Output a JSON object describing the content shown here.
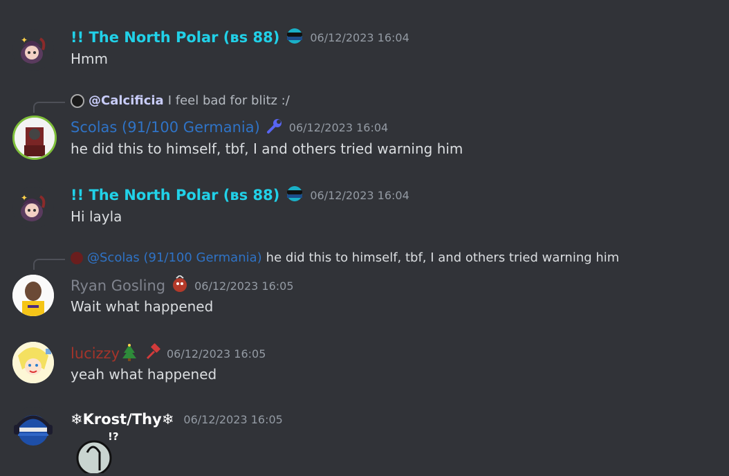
{
  "messages": [
    {
      "author": "!! The North Polar (ʙs 88)",
      "author_color": "#21d1e8",
      "timestamp": "06/12/2023 16:04",
      "text": "Hmm",
      "badge_icon": "sunglasses-ball-icon"
    },
    {
      "reply": {
        "mention": "@Calcificia",
        "text": "I feel bad for blitz :/"
      },
      "author": "Scolas (91/100 Germania)",
      "author_color": "#2f73c6",
      "timestamp": "06/12/2023 16:04",
      "text": "he did this to himself, tbf, I and others tried warning him",
      "badge_icon": "wrench-icon"
    },
    {
      "author": "!! The North Polar (ʙs 88)",
      "author_color": "#21d1e8",
      "timestamp": "06/12/2023 16:04",
      "text": "Hi layla",
      "badge_icon": "sunglasses-ball-icon"
    },
    {
      "reply": {
        "mention": "@Scolas (91/100 Germania)",
        "text": "he did this to himself, tbf, I and others tried warning him"
      },
      "author": "Ryan Gosling",
      "author_color": "#80848e",
      "timestamp": "06/12/2023 16:05",
      "text": "Wait what happened",
      "badge_icon": "clown-ball-icon"
    },
    {
      "author": "lucizzy",
      "author_color": "#a5342a",
      "timestamp": "06/12/2023 16:05",
      "text": "yeah what happened",
      "badge_icon": "tree-icon",
      "badge_icon_2": "hammer-icon"
    },
    {
      "author": "❄Krost/Thy❄",
      "author_color": "#ffffff",
      "timestamp": "06/12/2023 16:05",
      "sticker_text": "!?"
    }
  ]
}
